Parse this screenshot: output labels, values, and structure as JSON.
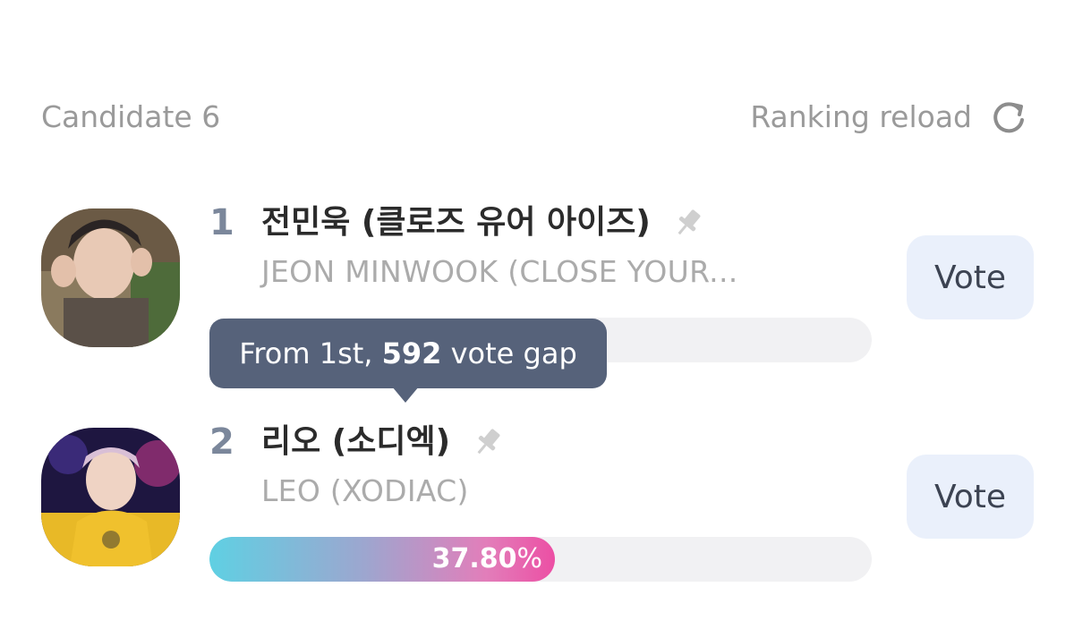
{
  "header": {
    "candidate_count": "Candidate 6",
    "reload_label": "Ranking reload",
    "reload_icon": "refresh-icon"
  },
  "candidates": [
    {
      "rank": "1",
      "name": "전민욱 (클로즈 유어 아이즈)",
      "subname": "JEON MINWOOK (CLOSE YOUR...",
      "vote_label": "Vote",
      "pin_icon": "pin-icon",
      "tooltip": {
        "prefix": "From 1st, ",
        "gap": "592",
        "suffix": " vote gap"
      }
    },
    {
      "rank": "2",
      "name": "리오 (소디엑)",
      "subname": "LEO (XODIAC)",
      "vote_label": "Vote",
      "pin_icon": "pin-icon",
      "percent_value": "37.80",
      "percent_unit": "%",
      "progress": 0.378
    }
  ],
  "colors": {
    "accent_gradient_start": "#5fd0e3",
    "accent_gradient_end": "#ec4fa4",
    "tooltip_bg": "#56627a",
    "vote_button_bg": "#eaf0fb"
  }
}
